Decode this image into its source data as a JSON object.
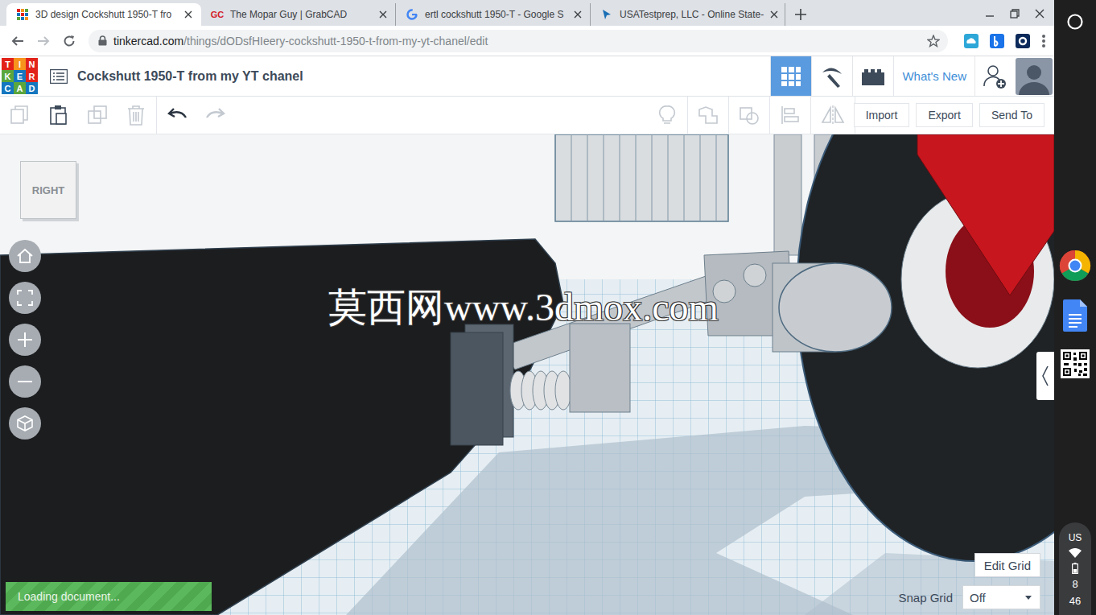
{
  "browser": {
    "tabs": [
      {
        "label": "3D design Cockshutt 1950-T fro",
        "selected": true,
        "kind": "tinkercad",
        "icon_text": ""
      },
      {
        "label": "The Mopar Guy | GrabCAD",
        "selected": false,
        "kind": "grabcad",
        "icon_text": "GC"
      },
      {
        "label": "ertl cockshutt 1950-T - Google S",
        "selected": false,
        "kind": "google",
        "icon_text": ""
      },
      {
        "label": "USATestprep, LLC - Online State-",
        "selected": false,
        "kind": "usatestprep",
        "icon_text": ""
      }
    ],
    "address": {
      "host": "tinkercad.com",
      "path": "/things/dODsfHIeery-cockshutt-1950-t-from-my-yt-chanel/edit"
    }
  },
  "app": {
    "logo": [
      {
        "letter": "T",
        "color": "#e2231a"
      },
      {
        "letter": "I",
        "color": "#f7941d"
      },
      {
        "letter": "N",
        "color": "#e2231a"
      },
      {
        "letter": "K",
        "color": "#5ba63d"
      },
      {
        "letter": "E",
        "color": "#1477bf"
      },
      {
        "letter": "R",
        "color": "#e2231a"
      },
      {
        "letter": "C",
        "color": "#1477bf"
      },
      {
        "letter": "A",
        "color": "#5ba63d"
      },
      {
        "letter": "D",
        "color": "#1477bf"
      }
    ],
    "title": "Cockshutt 1950-T from my YT chanel",
    "views": [
      {
        "selected": true
      },
      {
        "selected": false
      },
      {
        "selected": false
      }
    ],
    "whats_new": "What's New",
    "toolbar_buttons": [
      "Import",
      "Export",
      "Send To"
    ],
    "view_cube": "RIGHT",
    "edit_grid": "Edit Grid",
    "snap_grid": {
      "label": "Snap Grid",
      "value": "Off"
    },
    "loading": "Loading document..."
  },
  "watermark": "莫西网www.3dmox.com",
  "shelf": {
    "ime": "US",
    "hour": "8",
    "minute": "46"
  }
}
